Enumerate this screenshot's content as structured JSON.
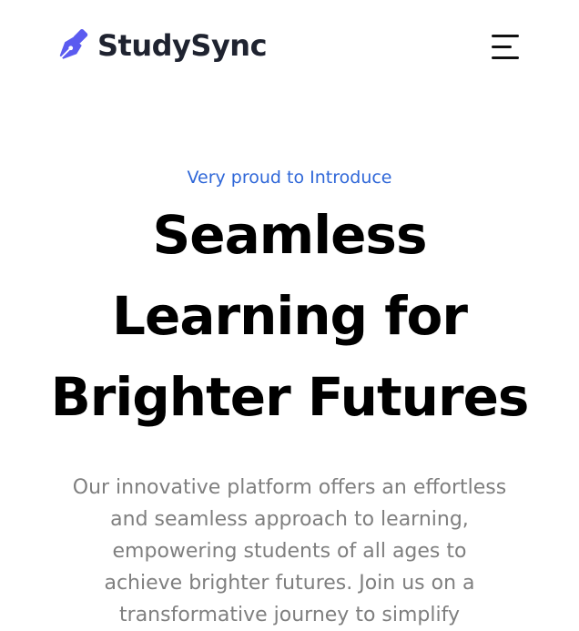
{
  "brand": {
    "name": "StudySync",
    "icon": "pen-nib-icon",
    "icon_color": "#5b5bf0"
  },
  "header": {
    "menu_icon": "hamburger-menu-icon"
  },
  "hero": {
    "eyebrow": "Very proud to Introduce",
    "headline_lines": [
      "Seamless",
      "Learning for",
      "Brighter Futures"
    ],
    "description_lines": [
      "Our innovative platform offers an effortless",
      "and seamless approach to learning,",
      "empowering students of all ages to",
      "achieve brighter futures. Join us on a",
      "transformative journey to simplify"
    ]
  },
  "colors": {
    "accent": "#2f67d8",
    "brand_text": "#1f2330",
    "headline": "#000000",
    "body_text": "#7f7f7f"
  }
}
